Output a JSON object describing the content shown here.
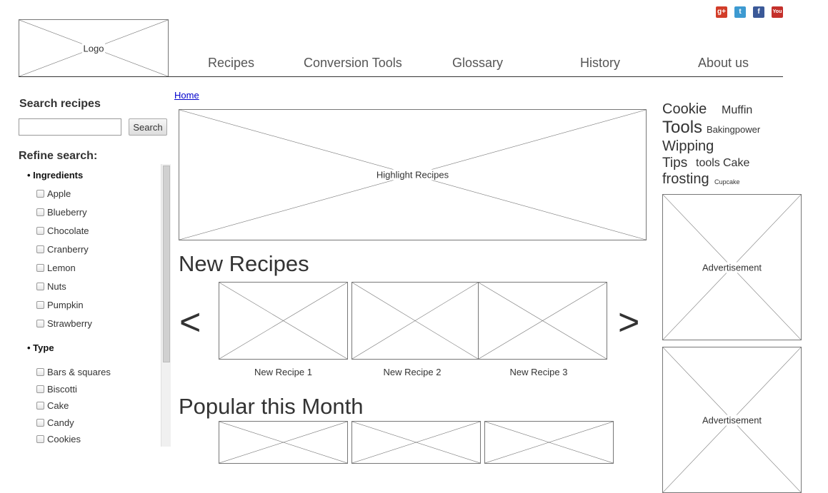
{
  "header": {
    "logo_label": "Logo",
    "nav": [
      "Recipes",
      "Conversion Tools",
      "Glossary",
      "History",
      "About us"
    ],
    "social": [
      {
        "icon": "google-plus-icon",
        "glyph": "g+",
        "color": "#d23d29"
      },
      {
        "icon": "twitter-icon",
        "glyph": "t",
        "color": "#3d9ad1"
      },
      {
        "icon": "facebook-icon",
        "glyph": "f",
        "color": "#3b5998"
      },
      {
        "icon": "youtube-icon",
        "glyph": "You",
        "color": "#c4302b"
      }
    ]
  },
  "breadcrumb": {
    "home": "Home"
  },
  "sidebar": {
    "search_title": "Search recipes",
    "search_placeholder": "",
    "search_button": "Search",
    "refine_title": "Refine search:",
    "groups": [
      {
        "title": "Ingredients",
        "items": [
          "Apple",
          "Blueberry",
          "Chocolate",
          "Cranberry",
          "Lemon",
          "Nuts",
          "Pumpkin",
          "Strawberry"
        ]
      },
      {
        "title": "Type",
        "items": [
          "Bars & squares",
          "Biscotti",
          "Cake",
          "Candy",
          "Cookies"
        ]
      }
    ]
  },
  "main": {
    "highlight_label": "Highlight Recipes",
    "new_recipes_title": "New Recipes",
    "prev_arrow": "<",
    "next_arrow": ">",
    "new_recipes": [
      "New Recipe 1",
      "New Recipe 2",
      "New Recipe 3"
    ],
    "popular_title": "Popular this Month"
  },
  "right": {
    "tags": [
      "Cookie",
      "Muffin",
      "Tools",
      "Bakingpower",
      "Wipping",
      "Tips",
      "tools",
      "Cake",
      "frosting",
      "Cupcake"
    ],
    "ad_label": "Advertisement"
  }
}
